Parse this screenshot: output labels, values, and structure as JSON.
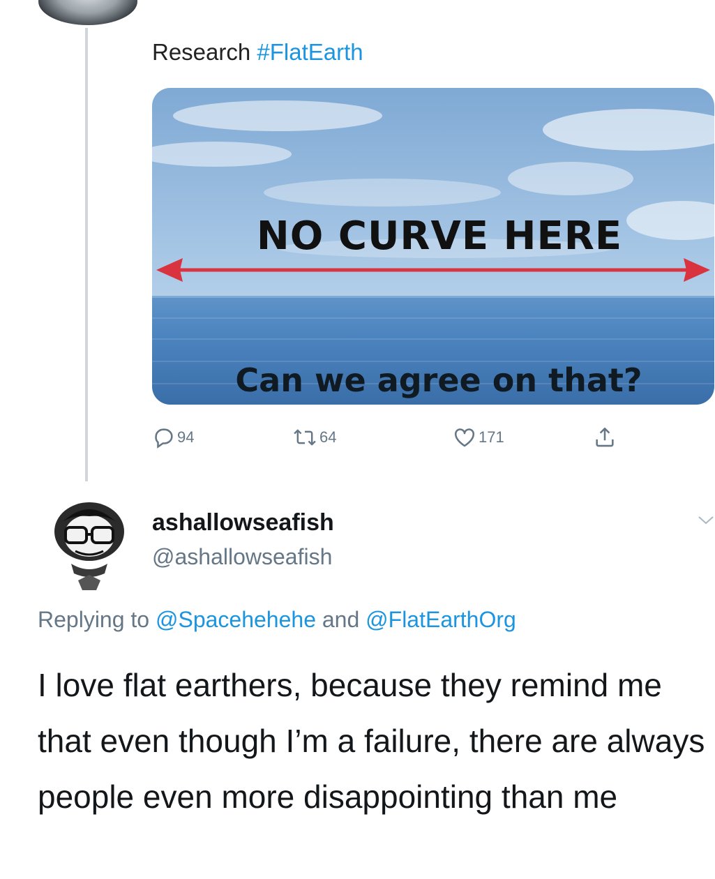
{
  "original_tweet": {
    "text_prefix": "Research ",
    "hashtag": "#FlatEarth",
    "image": {
      "headline": "NO CURVE HERE",
      "caption": "Can we agree on that?"
    },
    "actions": {
      "replies": "94",
      "retweets": "64",
      "likes": "171"
    }
  },
  "reply": {
    "display_name": "ashallowseafish",
    "handle": "@ashallowseafish",
    "replying_prefix": "Replying to ",
    "mention_1": "@Spacehehehe",
    "replying_join": " and ",
    "mention_2": "@FlatEarthOrg",
    "text": "I love flat earthers, because they remind me that even though I’m a failure, there are always people even more disappointing than me"
  },
  "icons": {
    "reply": "speech-bubble-icon",
    "retweet": "retweet-icon",
    "like": "heart-icon",
    "share": "share-icon",
    "more": "chevron-down-icon"
  },
  "colors": {
    "link": "#1b95e0",
    "secondary_text": "#657786",
    "arrow": "#d9333f"
  }
}
